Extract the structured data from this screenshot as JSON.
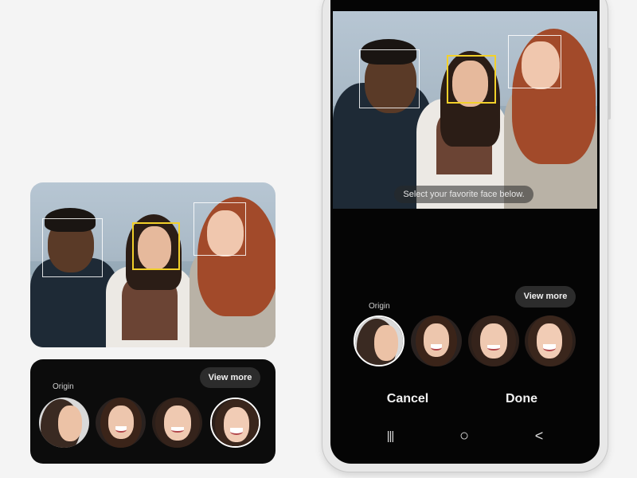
{
  "left_panel": {
    "origin_label": "Origin",
    "view_more_label": "View more"
  },
  "phone": {
    "hint_text": "Select your favorite face below.",
    "origin_label": "Origin",
    "view_more_label": "View more",
    "cancel_label": "Cancel",
    "done_label": "Done",
    "nav": {
      "recents_glyph": "|||",
      "home_glyph": "○",
      "back_glyph": "<"
    }
  },
  "colors": {
    "selected_face_box": "#f2d02a",
    "face_box": "#ffffff",
    "screen_bg": "#050505"
  },
  "icons": [
    "recents-icon",
    "home-icon",
    "back-icon"
  ]
}
